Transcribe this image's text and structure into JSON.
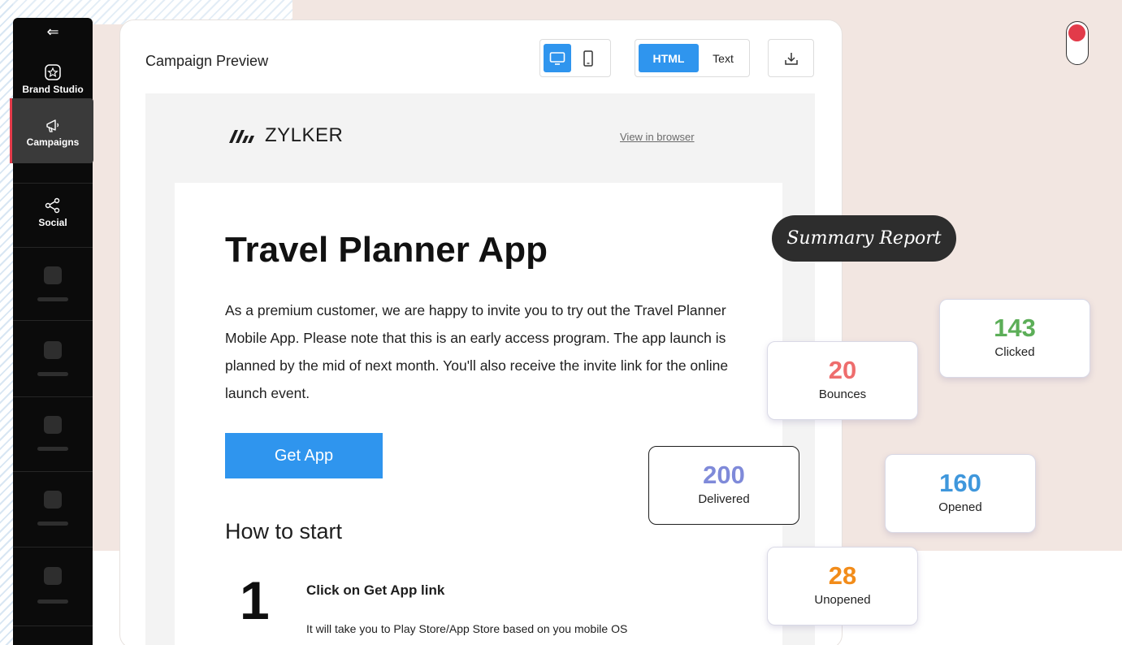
{
  "sidebar": {
    "back_icon": "back-arrow-icon",
    "items": [
      {
        "label": "Brand Studio",
        "icon": "star-badge-icon"
      },
      {
        "label": "Campaigns",
        "icon": "megaphone-icon",
        "active": true
      },
      {
        "label": "Social",
        "icon": "share-icon"
      }
    ],
    "accent": "#e23b4a"
  },
  "preview_panel": {
    "title": "Campaign Preview",
    "view_toggle": {
      "desktop_icon": "desktop-icon",
      "mobile_icon": "mobile-icon",
      "selected": "desktop"
    },
    "format_toggle": {
      "html_label": "HTML",
      "text_label": "Text",
      "selected": "HTML"
    },
    "download_icon": "download-icon",
    "accent": "#2f95ee"
  },
  "email": {
    "brand": "ZYLKER",
    "view_in_browser": "View in browser",
    "headline": "Travel Planner App",
    "body": "As a premium customer, we are happy to invite you to try out the Travel Planner Mobile App. Please note that this is an early access program. The app launch is planned by the mid of next month. You'll also receive the invite link for the online launch event.",
    "cta_label": "Get App",
    "section_heading": "How to start",
    "steps": [
      {
        "number": "1",
        "title": "Click on Get App link",
        "description": "It will take you to Play Store/App Store based on you mobile OS"
      }
    ]
  },
  "summary": {
    "title": "Summary Report",
    "stats": [
      {
        "key": "clicked",
        "value": "143",
        "label": "Clicked",
        "color": "#5cae58"
      },
      {
        "key": "bounces",
        "value": "20",
        "label": "Bounces",
        "color": "#ee6d6d"
      },
      {
        "key": "delivered",
        "value": "200",
        "label": "Delivered",
        "color": "#7f8ad9"
      },
      {
        "key": "opened",
        "value": "160",
        "label": "Opened",
        "color": "#3f97dc"
      },
      {
        "key": "unopened",
        "value": "28",
        "label": "Unopened",
        "color": "#f28c1a"
      }
    ]
  },
  "toggle": {
    "state": "on",
    "color": "#e23b4a"
  }
}
